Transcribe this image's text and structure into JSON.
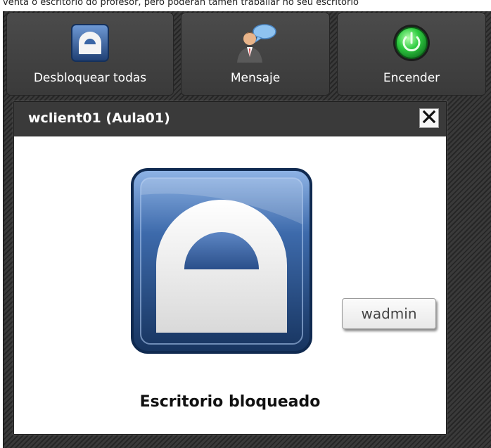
{
  "page": {
    "caption": "venta o escritorio do profesor, pero poderán tamén traballar no seu escritorio"
  },
  "toolbar": {
    "unlock_all_label": "Desbloquear todas",
    "message_label": "Mensaje",
    "power_on_label": "Encender"
  },
  "window": {
    "title": "wclient01 (Aula01)",
    "status": "Escritorio bloqueado"
  },
  "user_tag": "wadmin",
  "colors": {
    "panel_bg": "#2f2f2f",
    "titlebar_bg": "#3a3a3a",
    "lock_blue": "#2f5a96",
    "power_green": "#22b14c"
  },
  "icons": [
    "lock-icon",
    "message-user-icon",
    "power-icon",
    "close-icon"
  ]
}
